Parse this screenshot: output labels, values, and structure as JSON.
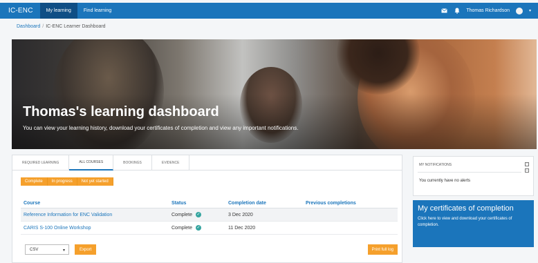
{
  "nav": {
    "brand": "IC-ENC",
    "links": [
      "My learning",
      "Find learning"
    ],
    "user_name": "Thomas Richardson",
    "icons": [
      "mail-icon",
      "bell-icon",
      "avatar",
      "chevron-down-icon"
    ]
  },
  "breadcrumb": {
    "home": "Dashboard",
    "separator": "/",
    "current": "IC-ENC Learner Dashboard"
  },
  "hero": {
    "title": "Thomas's learning dashboard",
    "subtitle": "You can view your learning history, download your certificates of completion and view any important notifications."
  },
  "tabs": [
    {
      "label": "REQUIRED LEARNING",
      "active": false
    },
    {
      "label": "ALL COURSES",
      "active": true
    },
    {
      "label": "BOOKINGS",
      "active": false
    },
    {
      "label": "EVIDENCE",
      "active": false
    }
  ],
  "filters": [
    "Complete",
    "In progress",
    "Not yet started"
  ],
  "table": {
    "columns": [
      "Course",
      "Status",
      "Completion date",
      "Previous completions"
    ],
    "rows": [
      {
        "course": "Reference Information for ENC Validation",
        "status": "Complete",
        "date": "3 Dec 2020",
        "previous": ""
      },
      {
        "course": "CARIS S-100 Online Workshop",
        "status": "Complete",
        "date": "11 Dec 2020",
        "previous": ""
      }
    ]
  },
  "export": {
    "format": "CSV",
    "export_label": "Export",
    "print_label": "Print full log"
  },
  "notifications": {
    "title": "MY NOTIFICATIONS",
    "message": "You currently have no alerts"
  },
  "certificates": {
    "title": "My certificates of completion",
    "description": "Click here to view and download your certificates of completion."
  },
  "colors": {
    "primary": "#1b75bb",
    "accent": "#f5a02c",
    "complete_check": "#36a5a0"
  }
}
